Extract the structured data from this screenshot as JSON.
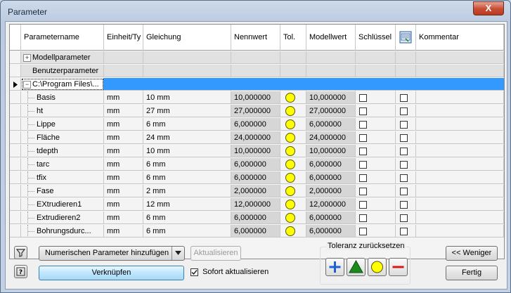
{
  "window": {
    "title": "Parameter",
    "close_label": "X"
  },
  "columns": [
    "Parametername",
    "Einheit/Ty",
    "Gleichung",
    "Nennwert",
    "Tol.",
    "Modellwert",
    "Schlüssel",
    "",
    "Kommentar"
  ],
  "groups": {
    "model": "Modellparameter",
    "user": "Benutzerparameter",
    "file": "C:\\Program Files\\..."
  },
  "rows": [
    {
      "name": "Basis",
      "unit": "mm",
      "equation": "10 mm",
      "nominal": "10,000000",
      "model": "10,000000"
    },
    {
      "name": "ht",
      "unit": "mm",
      "equation": "27 mm",
      "nominal": "27,000000",
      "model": "27,000000"
    },
    {
      "name": "Lippe",
      "unit": "mm",
      "equation": "6 mm",
      "nominal": "6,000000",
      "model": "6,000000"
    },
    {
      "name": "Fläche",
      "unit": "mm",
      "equation": "24 mm",
      "nominal": "24,000000",
      "model": "24,000000"
    },
    {
      "name": "tdepth",
      "unit": "mm",
      "equation": "10 mm",
      "nominal": "10,000000",
      "model": "10,000000"
    },
    {
      "name": "tarc",
      "unit": "mm",
      "equation": "6 mm",
      "nominal": "6,000000",
      "model": "6,000000"
    },
    {
      "name": "tfix",
      "unit": "mm",
      "equation": "6 mm",
      "nominal": "6,000000",
      "model": "6,000000"
    },
    {
      "name": "Fase",
      "unit": "mm",
      "equation": "2 mm",
      "nominal": "2,000000",
      "model": "2,000000"
    },
    {
      "name": "EXtrudieren1",
      "unit": "mm",
      "equation": "12 mm",
      "nominal": "12,000000",
      "model": "12,000000"
    },
    {
      "name": "Extrudieren2",
      "unit": "mm",
      "equation": "6 mm",
      "nominal": "6,000000",
      "model": "6,000000"
    },
    {
      "name": "Bohrungsdurc...",
      "unit": "mm",
      "equation": "6 mm",
      "nominal": "6,000000",
      "model": "6,000000"
    }
  ],
  "toolbar": {
    "add_numeric": "Numerischen Parameter hinzufügen",
    "update": "Aktualisieren",
    "link": "Verknüpfen",
    "auto_update": "Sofort aktualisieren",
    "tolerance_reset": "Toleranz zurücksetzen",
    "less": "<< Weniger",
    "done": "Fertig"
  },
  "icons": {
    "filter": "filter-icon",
    "help": "help-icon",
    "export": "export-parameters-icon",
    "tol_upper": "plus-icon",
    "tol_median": "triangle-icon",
    "tol_nominal": "circle-icon",
    "tol_lower": "minus-icon"
  },
  "colors": {
    "selection": "#3399ff",
    "tolerance_dot": "#ffff00",
    "plus": "#1f5fd6",
    "triangle": "#1a8a1a",
    "minus": "#d21a1a"
  }
}
